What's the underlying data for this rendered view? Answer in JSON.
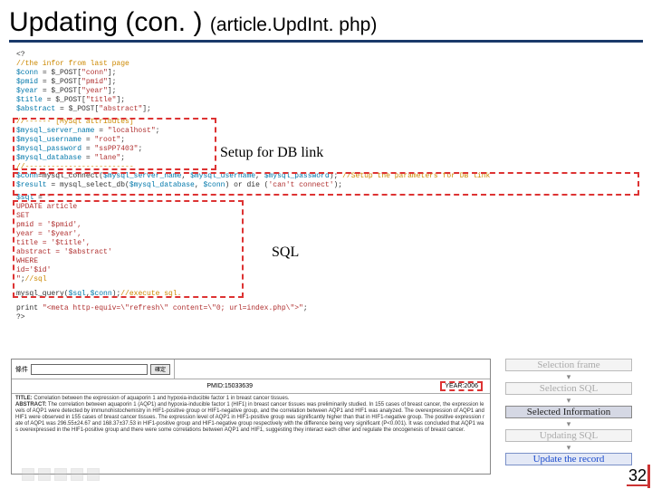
{
  "title": {
    "main": "Updating (con. )",
    "sub": "(article.UpdInt. php)"
  },
  "annotations": {
    "setup": "Setup for DB link",
    "sql": "SQL"
  },
  "code": {
    "l1": "<?",
    "l2": "//the infor from last page",
    "l3a": "$conn",
    "l3b": " = $_POST[",
    "l3c": "\"conn\"",
    "l3d": "];",
    "l4a": "$pmid",
    "l4b": " = $_POST[",
    "l4c": "\"pmid\"",
    "l4d": "];",
    "l5a": "$year",
    "l5b": " = $_POST[",
    "l5c": "\"year\"",
    "l5d": "];",
    "l6a": "$title",
    "l6b": " = $_POST[",
    "l6c": "\"title\"",
    "l6d": "];",
    "l7a": "$abstract",
    "l7b": " = $_POST[",
    "l7c": "\"abstract\"",
    "l7d": "];",
    "l8": "//------ [MySql attributes]",
    "l9a": "$mysql_server_name",
    "l9b": " = ",
    "l9c": "\"localhost\"",
    "l9d": ";",
    "l10a": "$mysql_username",
    "l10b": "    = ",
    "l10c": "\"root\"",
    "l10d": ";",
    "l11a": "$mysql_password",
    "l11b": "    = ",
    "l11c": "\"ssPP7403\"",
    "l11d": ";",
    "l12a": "$mysql_database",
    "l12b": "    = ",
    "l12c": "\"lane\"",
    "l12d": ";",
    "l13": "//-------------------------",
    "l14a": "$conn",
    "l14b": "=mysql_connect(",
    "l14c": "$mysql_server_name",
    "l14d": ", ",
    "l14e": "$mysql_username",
    "l14f": ", ",
    "l14g": "$mysql_password",
    "l14h": "); ",
    "l14i": "//Setup the parameters for DB link",
    "l15a": "$result",
    "l15b": " = mysql_select_db(",
    "l15c": "$mysql_database",
    "l15d": ", ",
    "l15e": "$conn",
    "l15f": ") or die (",
    "l15g": "'can't connect'",
    "l15h": ");",
    "l16a": "$sql",
    "l16b": " = ",
    "l16c": "\"",
    "l17": "UPDATE article",
    "l18": "SET",
    "l19": "pmid = '$pmid',",
    "l20": "year = '$year',",
    "l21": "title = '$title',",
    "l22": "abstract = '$abstract'",
    "l23": "WHERE",
    "l24": "id='$id'",
    "l25a": "\"",
    "l25b": ";",
    "l25c": "//sql",
    "l26a": "mysql_query(",
    "l26b": "$sql",
    "l26c": ",",
    "l26d": "$conn",
    "l26e": ");",
    "l26f": "//execute sql.",
    "l27a": "print ",
    "l27b": "\"<meta http-equiv=\\\"refresh\\\" content=\\\"0; url=index.php\\\">\"",
    "l27c": ";",
    "l28": "?>"
  },
  "form": {
    "search_label": "條件",
    "search_btn": "確定",
    "pmid_label": "PMID:",
    "pmid_value": "15033639",
    "year_label": "YEAR:",
    "year_value": "2006",
    "title_label": "TITLE:",
    "title_text": "Correlation between the expression of aquaporin 1 and hypoxia-inducible factor 1 in breast cancer tissues.",
    "abstract_label": "ABSTRACT:",
    "abstract_text": "The correlation between aquaporin 1 (AQP1) and hypoxia-inducible factor 1 (HIF1) in breast cancer tissues was preliminarily studied. In 155 cases of breast cancer, the expression levels of AQP1 were detected by immunohistochemistry in HIF1-positive group or HIF1-negative group, and the correlation between AQP1 and HIF1 was analyzed. The overexpression of AQP1 and HIF1 were observed in 155 cases of breast cancer tissues. The expression level of AQP1 in HIF1-positive group was significantly higher than that in HIF1-negative group. The positive expression rate of AQP1 was 296.55±24.67 and 168.37±37.53 in HIF1-positive group and HIF1-negative group respectively with the difference being very significant (P<0.001). It was concluded that AQP1 was overexpressed in the HIF1-positive group and there were some correlations between AQP1 and HIF1, suggesting they interact each other and regulate the oncogenesis of breast cancer."
  },
  "panel": {
    "a": "Selection frame",
    "b": "Selection SQL",
    "c": "Selected Information",
    "d": "Updating SQL",
    "e": "Update the record"
  },
  "page_number": "32"
}
